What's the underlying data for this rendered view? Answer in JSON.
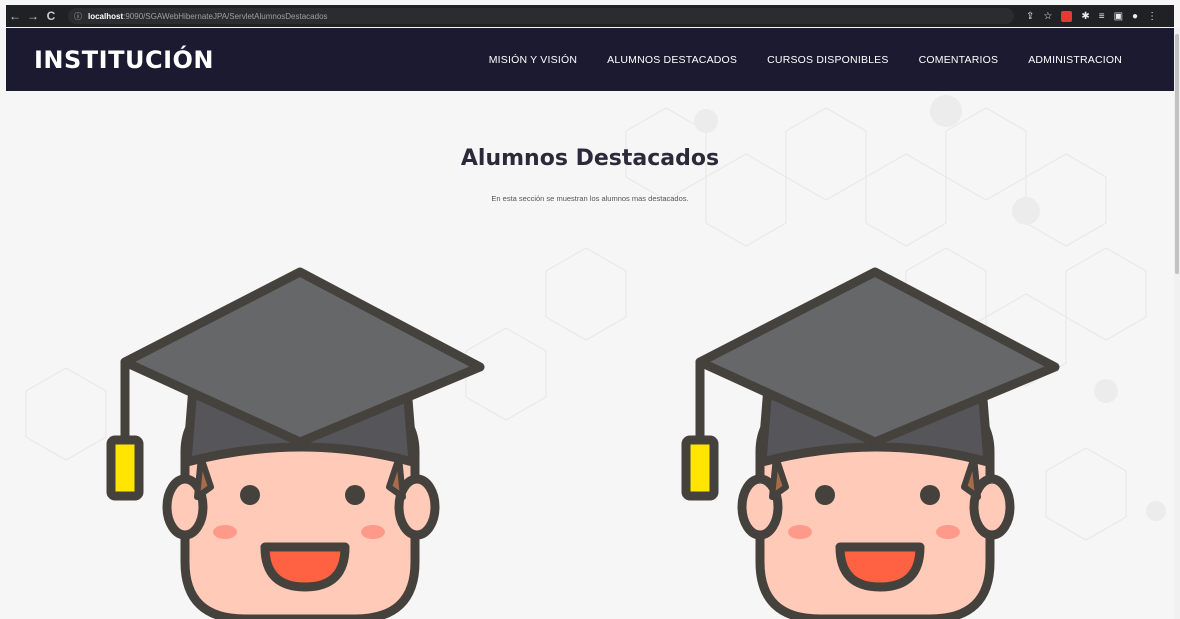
{
  "browser": {
    "url_host": "localhost",
    "url_rest": ":9090/SGAWebHibernateJPA/ServletAlumnosDestacados",
    "back_icon": "←",
    "forward_icon": "→",
    "reload_icon": "C",
    "info_icon": "ⓘ"
  },
  "site": {
    "logo": "INSTITUCIÓN",
    "menu": [
      "MISIÓN Y VISIÓN",
      "ALUMNOS DESTACADOS",
      "CURSOS DISPONIBLES",
      "COMENTARIOS",
      "ADMINISTRACION"
    ]
  },
  "main": {
    "title": "Alumnos Destacados",
    "subtitle": "En esta sección se muestran los alumnos mas destacados."
  },
  "colors": {
    "nav_bg": "#1c1a31",
    "cap": "#55555a",
    "skin": "#ffcab8",
    "outline": "#45413c",
    "tassel": "#ffe500"
  }
}
